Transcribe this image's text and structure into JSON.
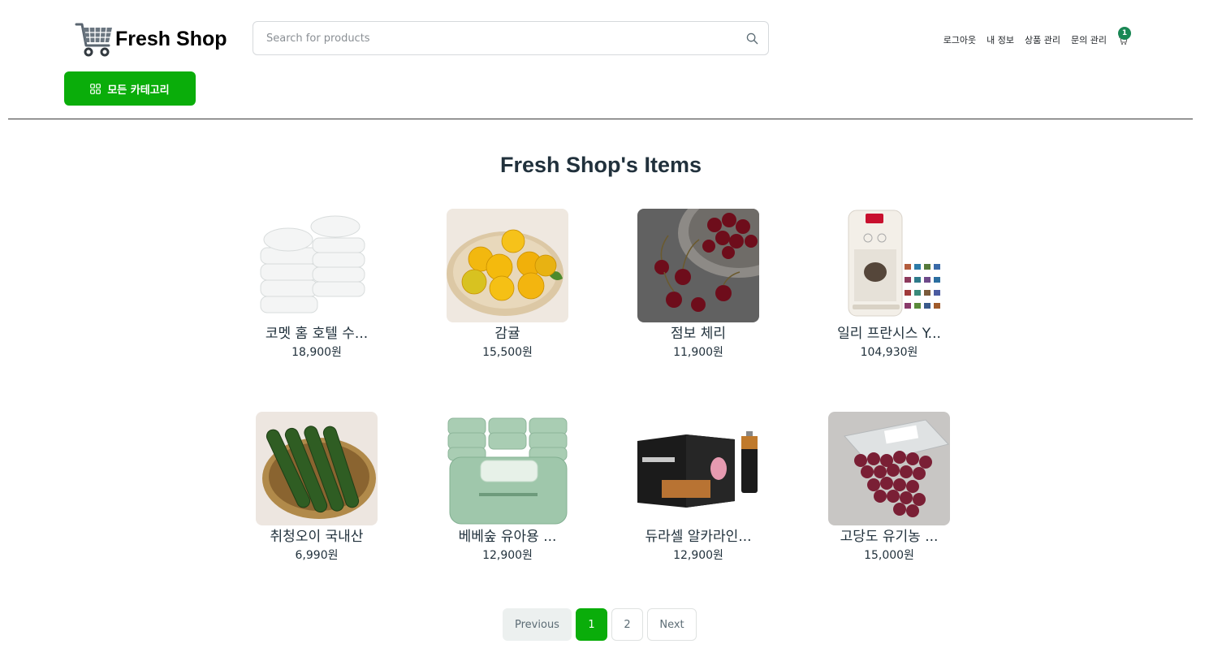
{
  "header": {
    "brand": "Fresh Shop",
    "search_placeholder": "Search for products",
    "nav": [
      "로그아웃",
      "내 정보",
      "상품 관리",
      "문의 관리"
    ],
    "cart_count": "1",
    "category_button": "모든 카테고리"
  },
  "colors": {
    "accent": "#0aad0a",
    "badge": "#198754",
    "title": "#21313c"
  },
  "section_title": "Fresh Shop's Items",
  "products": [
    {
      "name": "코멧 홈 호텔 수...",
      "price": "18,900원",
      "image": "towels"
    },
    {
      "name": "감귤",
      "price": "15,500원",
      "image": "tangerines"
    },
    {
      "name": "점보 체리",
      "price": "11,900원",
      "image": "cherries"
    },
    {
      "name": "일리 프란시스 Y...",
      "price": "104,930원",
      "image": "coffee-machine"
    },
    {
      "name": "취청오이 국내산",
      "price": "6,990원",
      "image": "cucumbers"
    },
    {
      "name": "베베숲 유아용 ...",
      "price": "12,900원",
      "image": "baby-wipes"
    },
    {
      "name": "듀라셀 알카라인...",
      "price": "12,900원",
      "image": "batteries"
    },
    {
      "name": "고당도 유기농 ...",
      "price": "15,000원",
      "image": "grapes"
    }
  ],
  "pagination": {
    "previous": "Previous",
    "pages": [
      "1",
      "2"
    ],
    "current": "1",
    "next": "Next"
  }
}
